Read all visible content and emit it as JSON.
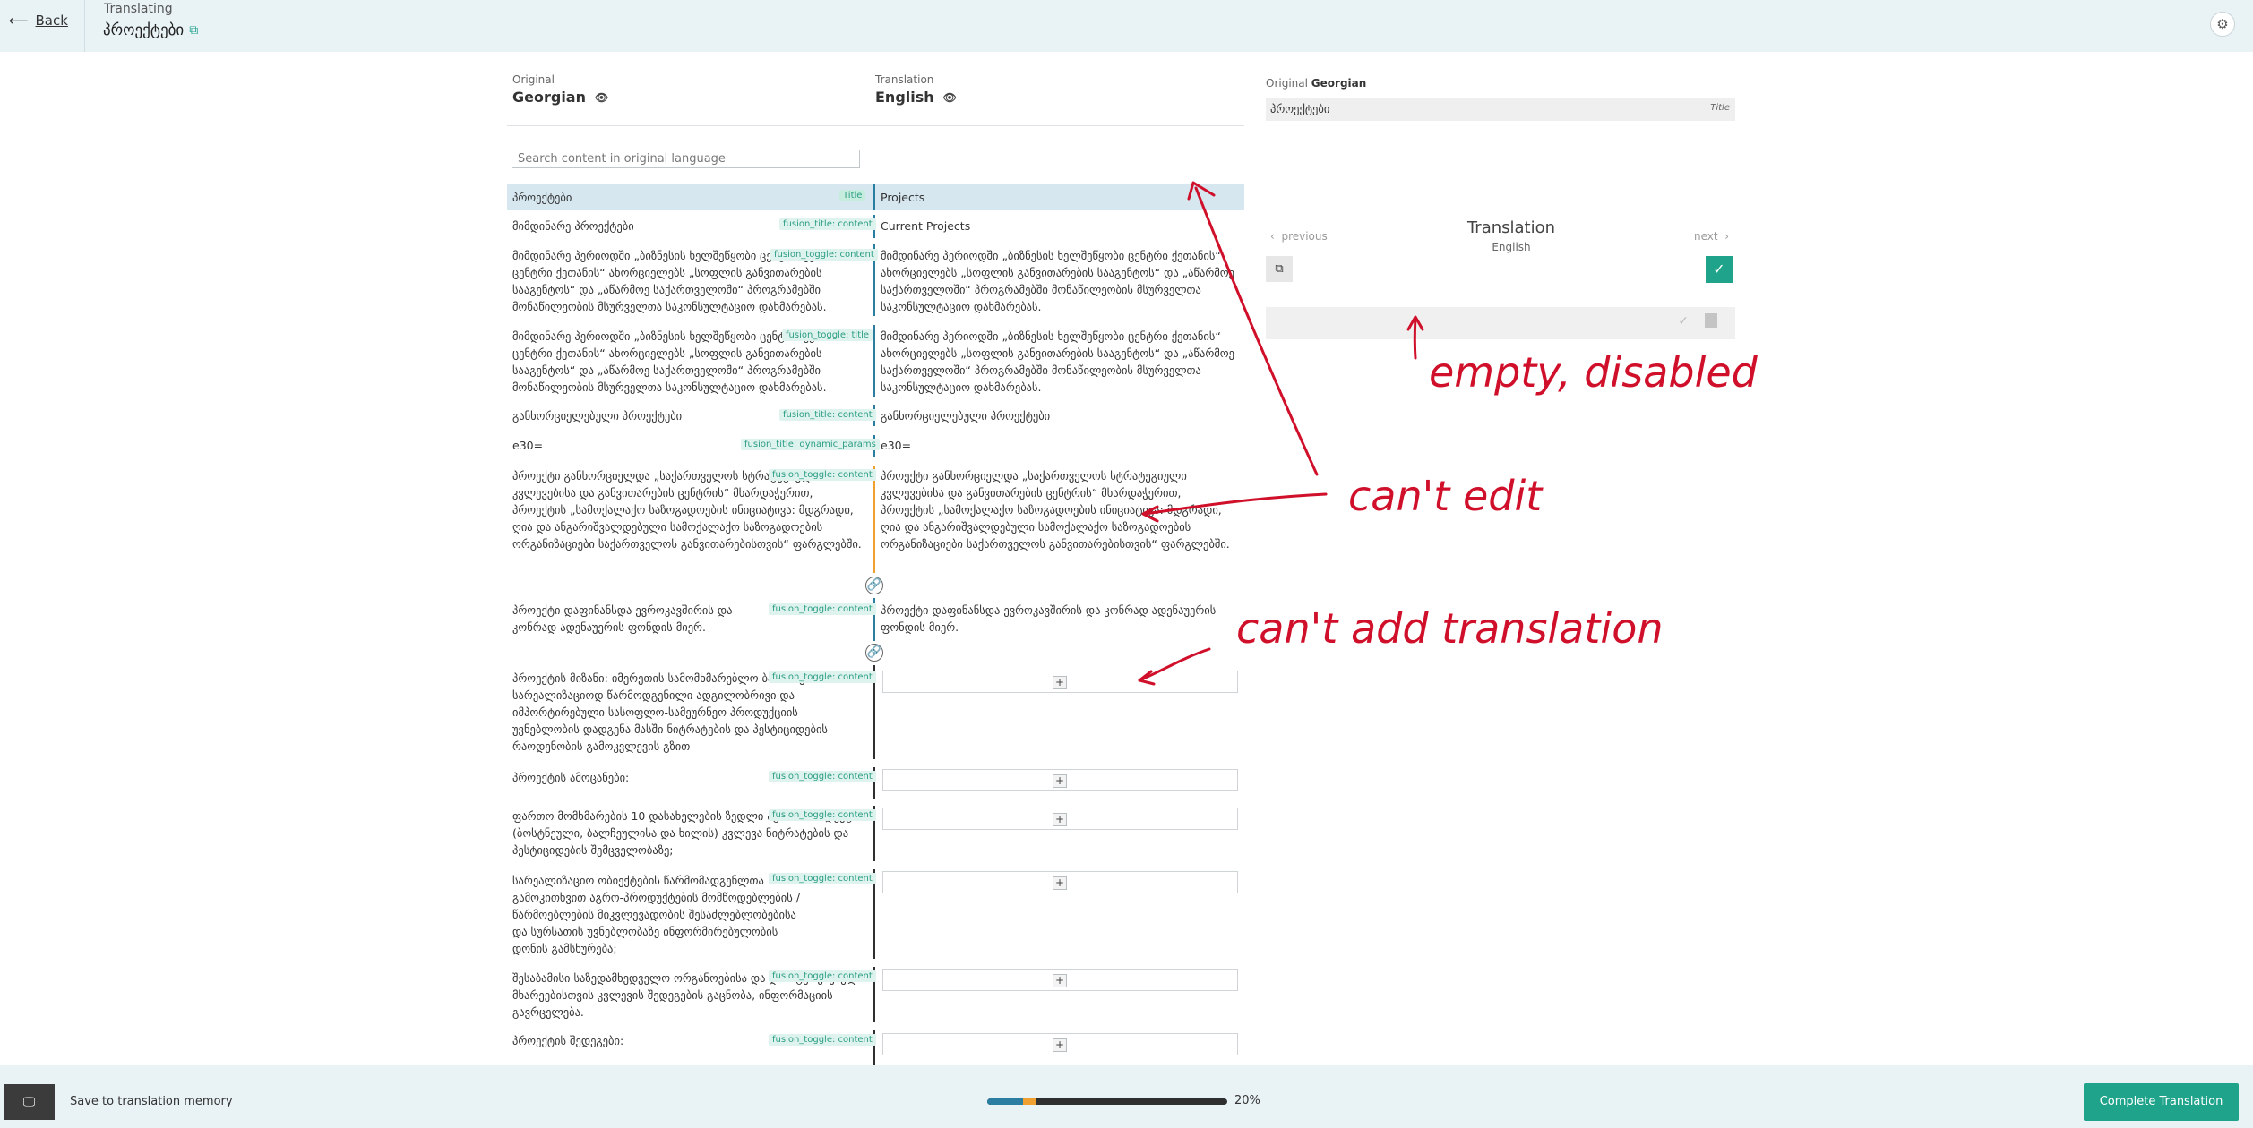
{
  "header": {
    "back_label": "Back",
    "section_label": "Translating",
    "project_name": "პროექტები"
  },
  "columns": {
    "original_caption": "Original",
    "original_language": "Georgian",
    "translation_caption": "Translation",
    "translation_language": "English"
  },
  "search": {
    "placeholder": "Search content in original language"
  },
  "rows": [
    {
      "original": "პროექტები",
      "tag": "Title",
      "translation": "Projects"
    },
    {
      "original": "მიმდინარე პროექტები",
      "tag": "fusion_title: content",
      "translation": "Current Projects"
    },
    {
      "original": "მიმდინარე პერიოდში „ბიზნესის ხელშეწყობი ცენტრი ქეთანის“ ცენტრი ქეთანის“ ახორციელებს „სოფლის განვითარების სააგენტოს“ და „აწარმოე საქართველოში“ პროგრამებში მონაწილეობის მსურველთა საკონსულტაციო დახმარებას.",
      "tag": "fusion_toggle: content",
      "translation": "მიმდინარე პერიოდში „ბიზნესის ხელშეწყობი ცენტრი ქეთანის“ ახორციელებს „სოფლის განვითარების სააგენტოს“ და „აწარმოე საქართველოში“ პროგრამებში მონაწილეობის მსურველთა საკონსულტაციო დახმარებას."
    },
    {
      "original": "მიმდინარე პერიოდში „ბიზნესის ხელშეწყობი ცენტრი ქეთანის“ ცენტრი ქეთანის“ ახორციელებს „სოფლის განვითარების სააგენტოს“ და „აწარმოე საქართველოში“ პროგრამებში მონაწილეობის მსურველთა საკონსულტაციო დახმარებას.",
      "tag": "fusion_toggle: title",
      "translation": "მიმდინარე პერიოდში „ბიზნესის ხელშეწყობი ცენტრი ქეთანის“ ახორციელებს „სოფლის განვითარების სააგენტოს“ და „აწარმოე საქართველოში“ პროგრამებში მონაწილეობის მსურველთა საკონსულტაციო დახმარებას."
    },
    {
      "original": "განხორციელებული პროექტები",
      "tag": "fusion_title: content",
      "translation": "განხორციელებული პროექტები"
    },
    {
      "original": "e30=",
      "tag": "fusion_title: dynamic_params",
      "translation": "e30="
    },
    {
      "original": "პროექტი განხორციელდა „საქართველოს სტრატეგიული კვლევებისა და განვითარების ცენტრის“ მხარდაჭერით, პროექტის „სამოქალაქო საზოგადოების ინიციატივა: მდგრადი, ღია და ანგარიშვალდებული სამოქალაქო საზოგადოების ორგანიზაციები საქართველოს განვითარებისთვის“ ფარგლებში.",
      "tag": "fusion_toggle: content",
      "translation": "პროექტი განხორციელდა „საქართველოს სტრატეგიული კვლევებისა და განვითარების ცენტრის“ მხარდაჭერით, პროექტის „სამოქალაქო საზოგადოების ინიციატივა: მდგრადი, ღია და ანგარიშვალდებული სამოქალაქო საზოგადოების ორგანიზაციები საქართველოს განვითარებისთვის“ ფარგლებში."
    },
    {
      "original": "პროექტი დაფინანსდა ევროკავშირის და კონრად ადენაუერის ფონდის მიერ.",
      "tag": "fusion_toggle: content",
      "translation": "პროექტი დაფინანსდა ევროკავშირის და კონრად ადენაუერის ფონდის მიერ."
    },
    {
      "original": "პროექტის მიზანი: იმერეთის სამომხმარებლო ბაზარზე სარეალიზაციოდ წარმოდგენილი ადგილობრივი და იმპორტირებული სასოფლო-სამეურნეო პროდუქციის უვნებლობის დადგენა მასში ნიტრატების და პესტიციდების რაოდენობის გამოკვლევის გზით",
      "tag": "fusion_toggle: content",
      "translation": ""
    },
    {
      "original": "პროექტის ამოცანები:",
      "tag": "fusion_toggle: content",
      "translation": ""
    },
    {
      "original": "ფართო მომხმარების 10 დასახელების ზედლი აგრო-პროდუქტის (ბოსტნეული, ბალჩეულისა და ხილის) კვლევა ნიტრატების და პესტიციდების შემცველობაზე;",
      "tag": "fusion_toggle: content",
      "translation": ""
    },
    {
      "original": "სარეალიზაციო ობიექტების წარმომადგენლთა გამოკითხვით აგრო-პროდუქტების მომწოდებლების / წარმოებლების მიკვლევადობის შესაძლებლობებისა და სურსათის უვნებლობაზე ინფორმირებულობის დონის გამსხურება;",
      "tag": "fusion_toggle: content",
      "translation": ""
    },
    {
      "original": "შესაბამისი საზედამხედველო ორგანოებისა და დაინტერესებული მხარეებისთვის კვლევის შედეგების გაცნობა, ინფორმაციის გავრცელება.",
      "tag": "fusion_toggle: content",
      "translation": ""
    },
    {
      "original": "პროექტის შედეგები:",
      "tag": "fusion_toggle: content",
      "translation": ""
    }
  ],
  "side_panel": {
    "original_caption": "Original",
    "original_language": "Georgian",
    "original_text": "პროექტები",
    "original_tag": "Title",
    "previous_label": "previous",
    "next_label": "next",
    "title": "Translation",
    "subtitle": "English"
  },
  "footer": {
    "memory_label": "Save to translation memory",
    "progress_percent": 20,
    "progress_label": "20%",
    "complete_label": "Complete Translation"
  },
  "annotations": {
    "note_disabled": "empty, disabled",
    "note_edit": "can't edit",
    "note_add": "can't add translation"
  },
  "colors": {
    "accent": "#1fa38a",
    "translated_bar": "#2b7ea1",
    "untranslated_bar": "#2f2f2f",
    "warning_bar": "#f0a030",
    "annotation": "#d0102a"
  }
}
